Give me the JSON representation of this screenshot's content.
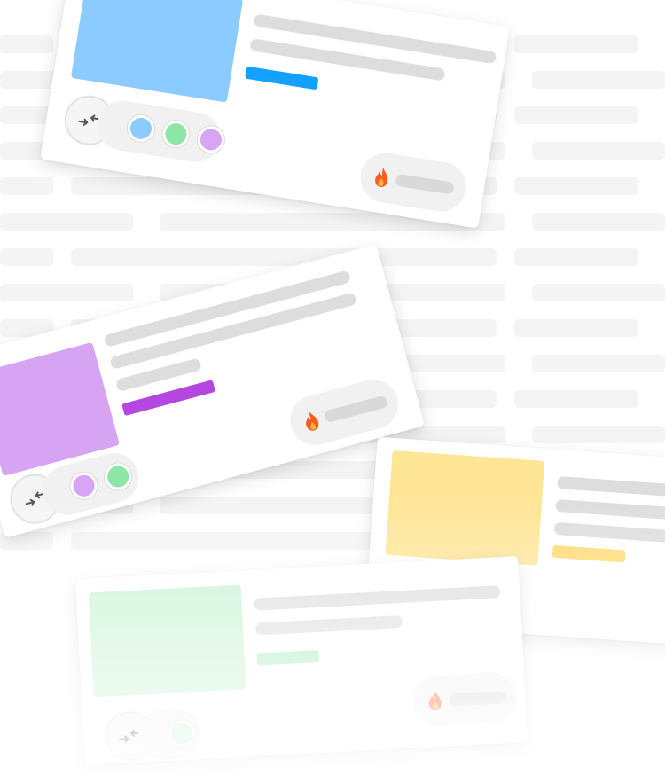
{
  "colors": {
    "background": "#ffffff",
    "skeleton_background": "#f4f4f4",
    "skeleton_line": "#dddddd",
    "pill_background": "#f1f1f1",
    "flame": "#ff5a1f",
    "flame_inner": "#ffb341"
  },
  "cards": [
    {
      "id": "card-blue",
      "thumbnail_color": "#8ccbff",
      "accent_color": "#14a0ff",
      "swatches": [
        "#8ccbff",
        "#8ee6a6",
        "#d8a4f4"
      ],
      "icons": [
        "swap-arrows-icon",
        "flame-icon"
      ]
    },
    {
      "id": "card-purple",
      "thumbnail_color": "#d7a3f3",
      "accent_color": "#b347e0",
      "swatches": [
        "#d8a4f4",
        "#8ee6a6"
      ],
      "icons": [
        "swap-arrows-icon",
        "flame-icon"
      ]
    },
    {
      "id": "card-yellow",
      "thumbnail_color": "#ffe596",
      "accent_color": "#ffd970",
      "swatches": [],
      "icons": []
    },
    {
      "id": "card-green",
      "thumbnail_color": "#c8f2d3",
      "accent_color": "#a8ecbe",
      "swatches": [
        "#c8f2d3"
      ],
      "icons": [
        "swap-arrows-icon",
        "flame-icon"
      ]
    }
  ]
}
